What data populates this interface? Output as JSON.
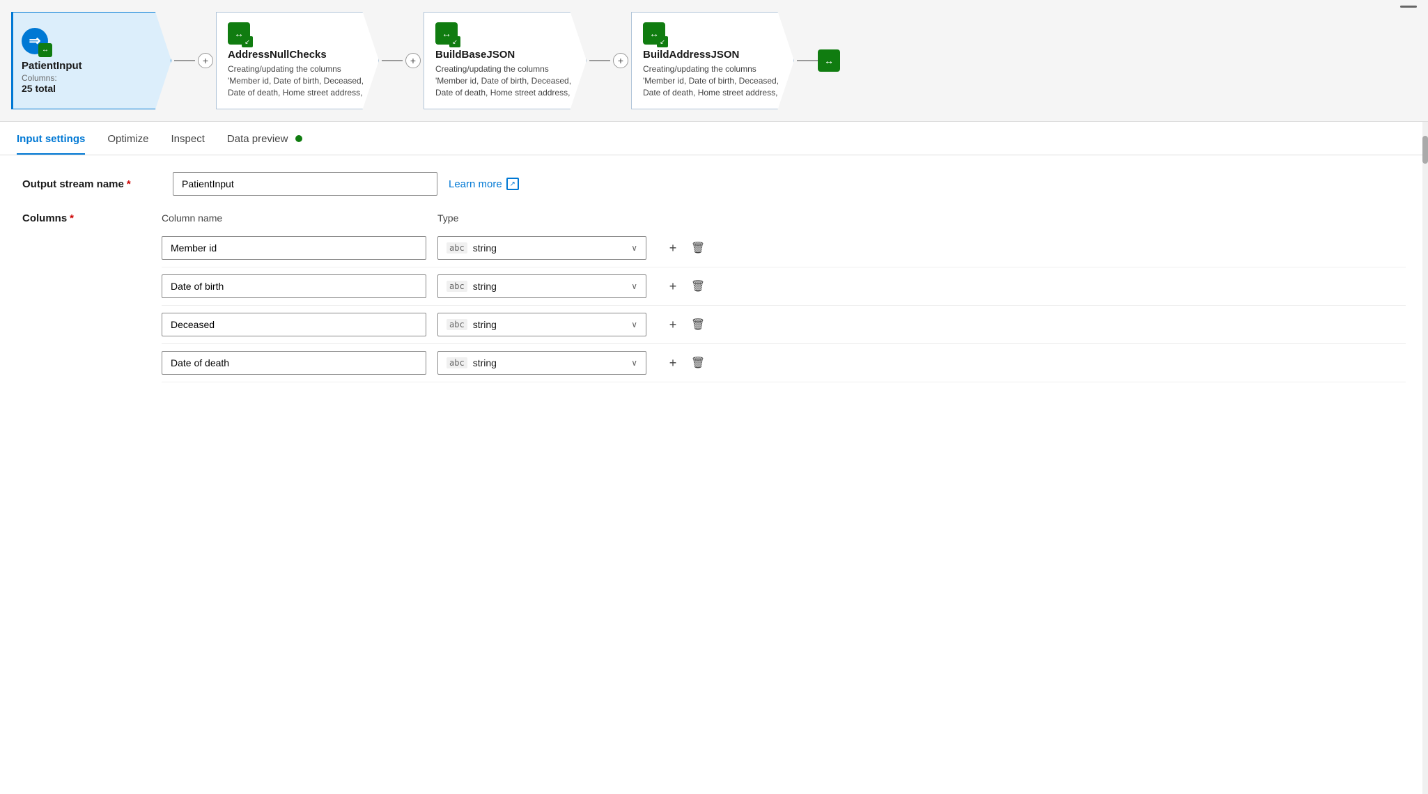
{
  "pipeline": {
    "nodes": [
      {
        "id": "patient-input",
        "title": "PatientInput",
        "subtitle": "Columns:",
        "count": "25 total",
        "type": "source",
        "active": true
      },
      {
        "id": "address-null-checks",
        "title": "AddressNullChecks",
        "desc": "Creating/updating the columns 'Member id, Date of birth, Deceased, Date of death, Home street address,",
        "type": "transform"
      },
      {
        "id": "build-base-json",
        "title": "BuildBaseJSON",
        "desc": "Creating/updating the columns 'Member id, Date of birth, Deceased, Date of death, Home street address,",
        "type": "transform"
      },
      {
        "id": "build-address-json",
        "title": "BuildAddressJSON",
        "desc": "Creating/updating the columns 'Member id, Date of birth, Deceased, Date of death, Home street address,",
        "type": "transform"
      }
    ]
  },
  "tabs": [
    {
      "id": "input-settings",
      "label": "Input settings",
      "active": true
    },
    {
      "id": "optimize",
      "label": "Optimize",
      "active": false
    },
    {
      "id": "inspect",
      "label": "Inspect",
      "active": false
    },
    {
      "id": "data-preview",
      "label": "Data preview",
      "active": false,
      "dot": true
    }
  ],
  "form": {
    "output_stream_name_label": "Output stream name",
    "output_stream_name_value": "PatientInput",
    "learn_more_label": "Learn more",
    "columns_label": "Columns",
    "col_header_name": "Column name",
    "col_header_type": "Type"
  },
  "columns": [
    {
      "id": "col-1",
      "name": "Member id",
      "type_badge": "abc",
      "type_label": "string"
    },
    {
      "id": "col-2",
      "name": "Date of birth",
      "type_badge": "abc",
      "type_label": "string"
    },
    {
      "id": "col-3",
      "name": "Deceased",
      "type_badge": "abc",
      "type_label": "string"
    },
    {
      "id": "col-4",
      "name": "Date of death",
      "type_badge": "abc",
      "type_label": "string"
    }
  ],
  "icons": {
    "source_icon": "⇒",
    "transform_icon": "↔",
    "plus": "+",
    "chevron_down": "∨",
    "external_link": "↗",
    "add": "+",
    "delete": "🗑"
  }
}
